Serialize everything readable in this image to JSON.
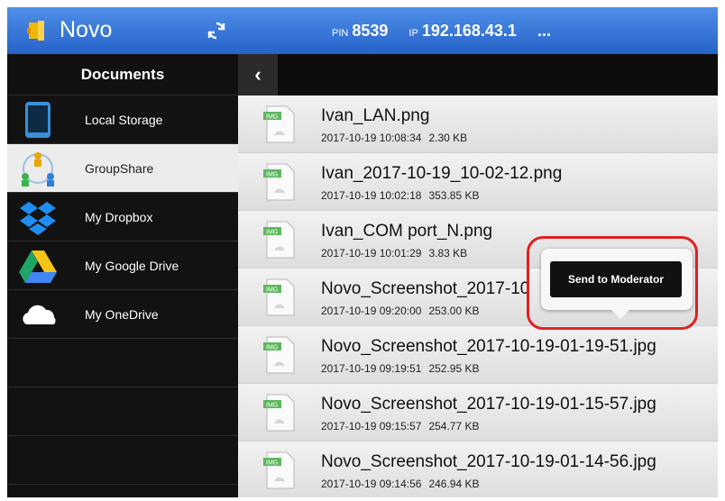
{
  "header": {
    "app_name": "Novo",
    "pin_label": "PIN",
    "pin_value": "8539",
    "ip_label": "IP",
    "ip_value": "192.168.43.1",
    "more": "..."
  },
  "sidebar": {
    "title": "Documents",
    "items": [
      {
        "label": "Local Storage",
        "icon": "tablet-icon"
      },
      {
        "label": "GroupShare",
        "icon": "groupshare-icon"
      },
      {
        "label": "My Dropbox",
        "icon": "dropbox-icon"
      },
      {
        "label": "My Google Drive",
        "icon": "google-drive-icon"
      },
      {
        "label": "My OneDrive",
        "icon": "onedrive-icon"
      }
    ]
  },
  "files": [
    {
      "name": "Ivan_LAN.png",
      "date": "2017-10-19 10:08:34",
      "size": "2.30 KB"
    },
    {
      "name": "Ivan_2017-10-19_10-02-12.png",
      "date": "2017-10-19 10:02:18",
      "size": "353.85 KB"
    },
    {
      "name": "Ivan_COM port_N.png",
      "date": "2017-10-19 10:01:29",
      "size": "3.83 KB"
    },
    {
      "name": "Novo_Screenshot_2017-10",
      "date": "2017-10-19 09:20:00",
      "size": "253.00 KB"
    },
    {
      "name": "Novo_Screenshot_2017-10-19-01-19-51.jpg",
      "date": "2017-10-19 09:19:51",
      "size": "252.95 KB"
    },
    {
      "name": "Novo_Screenshot_2017-10-19-01-15-57.jpg",
      "date": "2017-10-19 09:15:57",
      "size": "254.77 KB"
    },
    {
      "name": "Novo_Screenshot_2017-10-19-01-14-56.jpg",
      "date": "2017-10-19 09:14:56",
      "size": "246.94 KB"
    }
  ],
  "file_icon_badge": "IMG",
  "popup": {
    "button_label": "Send to Moderator"
  },
  "back_glyph": "‹",
  "colors": {
    "header_blue": "#2563c9",
    "highlight_ring": "#e02020"
  }
}
